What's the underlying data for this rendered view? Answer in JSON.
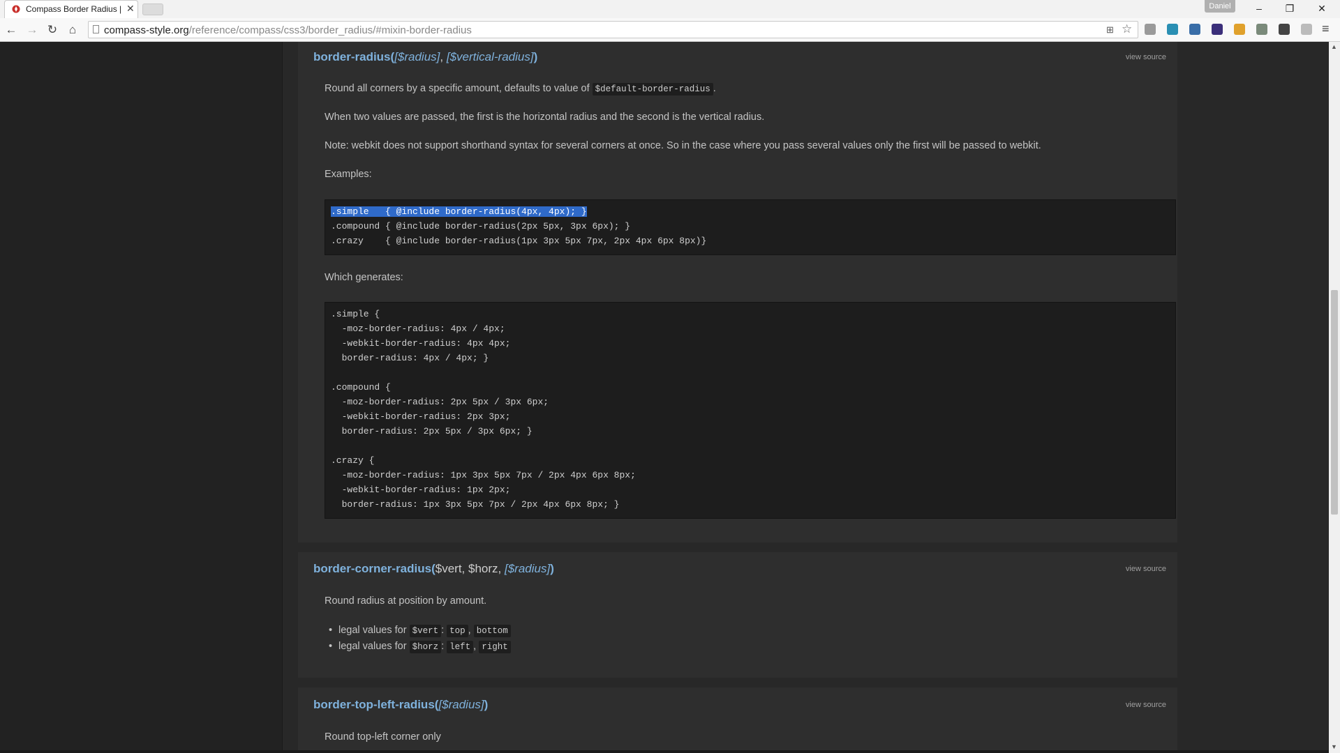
{
  "browser": {
    "tab_title": "Compass Border Radius |",
    "tab_close": "✕",
    "profile_name": "Daniel",
    "window_controls": {
      "minimize": "–",
      "restore": "❐",
      "close": "✕"
    },
    "nav": {
      "back": "←",
      "forward": "→",
      "reload": "↻",
      "home": "⌂"
    },
    "url_host": "compass-style.org",
    "url_path": "/reference/compass/css3/border_radius/#mixin-border-radius",
    "menu_icon": "≡",
    "extensions": [
      {
        "name": "extension-1-icon",
        "color": "#9a9a9a"
      },
      {
        "name": "extension-2-icon",
        "color": "#2a8fb3"
      },
      {
        "name": "extension-3-icon",
        "color": "#3a6ea8"
      },
      {
        "name": "extension-4-icon",
        "color": "#3b2f7a"
      },
      {
        "name": "extension-5-icon",
        "color": "#e0a12c"
      },
      {
        "name": "extension-6-icon",
        "color": "#7a8a7a"
      },
      {
        "name": "extension-7-icon",
        "color": "#444444"
      },
      {
        "name": "extension-8-icon",
        "color": "#bbbbbb"
      }
    ]
  },
  "mixins": {
    "border_radius": {
      "name": "border-radius(",
      "args": [
        "[$radius]",
        "[$vertical-radius]"
      ],
      "close": ")",
      "view_source": "view source",
      "desc1_before": "Round all corners by a specific amount, defaults to value of",
      "desc1_code": "$default-border-radius",
      "desc1_after": ".",
      "desc2": "When two values are passed, the first is the horizontal radius and the second is the vertical radius.",
      "desc3": "Note: webkit does not support shorthand syntax for several corners at once. So in the case where you pass several values only the first will be passed to webkit.",
      "examples_label": "Examples:",
      "examples_code": [
        ".simple   { @include border-radius(4px, 4px); }",
        ".compound { @include border-radius(2px 5px, 3px 6px); }",
        ".crazy    { @include border-radius(1px 3px 5px 7px, 2px 4px 6px 8px)}"
      ],
      "generates_label": "Which generates:",
      "generated_code": [
        ".simple {",
        "  -moz-border-radius: 4px / 4px;",
        "  -webkit-border-radius: 4px 4px;",
        "  border-radius: 4px / 4px; }",
        "",
        ".compound {",
        "  -moz-border-radius: 2px 5px / 3px 6px;",
        "  -webkit-border-radius: 2px 3px;",
        "  border-radius: 2px 5px / 3px 6px; }",
        "",
        ".crazy {",
        "  -moz-border-radius: 1px 3px 5px 7px / 2px 4px 6px 8px;",
        "  -webkit-border-radius: 1px 2px;",
        "  border-radius: 1px 3px 5px 7px / 2px 4px 6px 8px; }"
      ]
    },
    "border_corner_radius": {
      "name": "border-corner-radius(",
      "arg1": "$vert",
      "arg2": "$horz",
      "arg3": "[$radius]",
      "close": ")",
      "view_source": "view source",
      "desc": "Round radius at position by amount.",
      "bullets": [
        {
          "label": "legal values for",
          "var": "$vert",
          "values": [
            "top",
            "bottom"
          ]
        },
        {
          "label": "legal values for",
          "var": "$horz",
          "values": [
            "left",
            "right"
          ]
        }
      ]
    },
    "border_top_left_radius": {
      "name": "border-top-left-radius(",
      "arg": "[$radius]",
      "close": ")",
      "view_source": "view source",
      "desc": "Round top-left corner only"
    }
  },
  "scrollbar": {
    "up": "▲",
    "down": "▼"
  }
}
